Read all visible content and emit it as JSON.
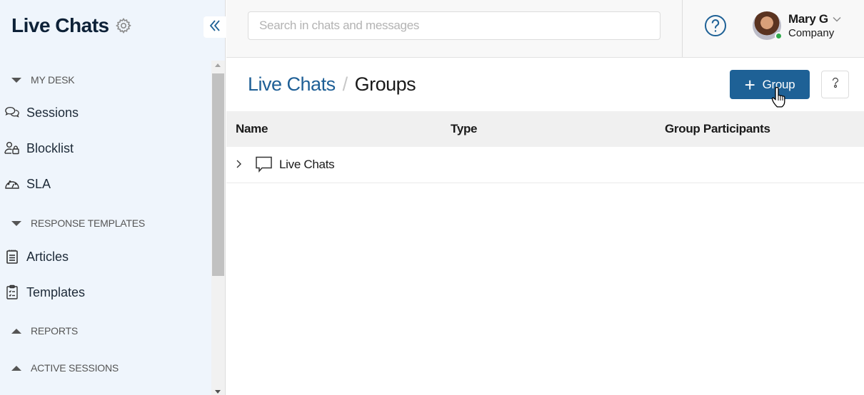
{
  "sidebar": {
    "title": "Live Chats",
    "settings_icon": "gear-icon",
    "collapse_icon": "double-chevron-left-icon",
    "sections": [
      {
        "label": "MY DESK",
        "expanded": true,
        "items": [
          {
            "label": "Sessions",
            "icon": "chat-bubbles-icon"
          },
          {
            "label": "Blocklist",
            "icon": "user-lock-icon"
          },
          {
            "label": "SLA",
            "icon": "gauge-icon"
          }
        ]
      },
      {
        "label": "RESPONSE TEMPLATES",
        "expanded": true,
        "items": [
          {
            "label": "Articles",
            "icon": "clipboard-icon"
          },
          {
            "label": "Templates",
            "icon": "clipboard-list-icon"
          }
        ]
      },
      {
        "label": "REPORTS",
        "expanded": false,
        "items": []
      },
      {
        "label": "ACTIVE SESSIONS",
        "expanded": false,
        "items": []
      }
    ]
  },
  "topbar": {
    "search_placeholder": "Search in chats and messages",
    "search_value": "",
    "help_icon": "question-circle-icon",
    "user": {
      "name": "Mary G",
      "company": "Company",
      "status": "online",
      "status_color": "#2eaa4a"
    }
  },
  "page": {
    "breadcrumb": [
      {
        "label": "Live Chats",
        "link": true
      },
      {
        "label": "Groups",
        "link": false
      }
    ],
    "breadcrumb_separator": "/",
    "add_button": {
      "plus": "+",
      "label": "Group"
    },
    "help_button_icon": "question-mark-icon"
  },
  "table": {
    "columns": [
      "Name",
      "Type",
      "Group Participants"
    ],
    "rows": [
      {
        "name": "Live Chats",
        "type": "",
        "participants": "",
        "icon": "chat-bubble-icon",
        "expandable": true
      }
    ]
  },
  "colors": {
    "accent": "#1e6196",
    "link": "#1e5f96",
    "sidebar_bg": "#eff5fc",
    "brand_title": "#0d2137"
  }
}
